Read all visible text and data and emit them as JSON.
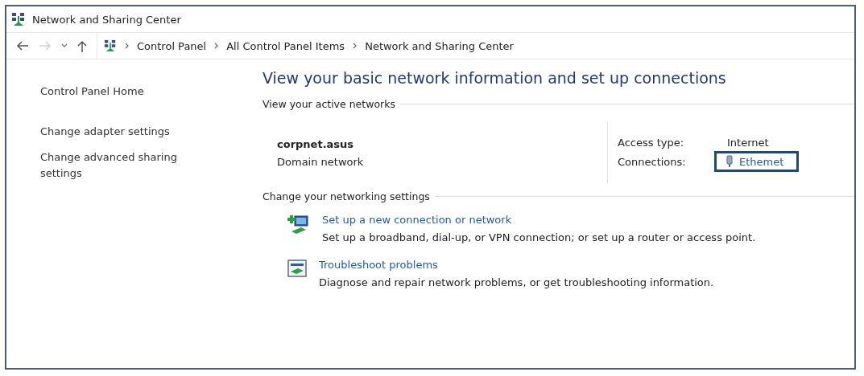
{
  "window": {
    "title": "Network and Sharing Center"
  },
  "nav": {
    "back": {
      "disabled": false
    },
    "forward": {
      "disabled": true
    }
  },
  "breadcrumb": [
    "Control Panel",
    "All Control Panel Items",
    "Network and Sharing Center"
  ],
  "sidebar": {
    "items": [
      {
        "label": "Control Panel Home"
      },
      {
        "label": "Change adapter settings"
      },
      {
        "label": "Change advanced sharing settings"
      }
    ]
  },
  "heading": "View your basic network information and set up connections",
  "active_networks": {
    "section": "View your active networks",
    "name": "corpnet.asus",
    "category": "Domain network",
    "access_label": "Access type:",
    "access_value": "Internet",
    "connections_label": "Connections:",
    "connection": {
      "label": "Ethemet",
      "focused": true
    }
  },
  "settings": {
    "section": "Change your networking settings",
    "tasks": [
      {
        "kind": "new-connection",
        "title": "Set up a new connection or network",
        "description": "Set up a broadband, dial-up, or VPN connection; or set up a router or access point."
      },
      {
        "kind": "troubleshoot",
        "title": "Troubleshoot problems",
        "description": "Diagnose and repair network problems, or get troubleshooting information."
      }
    ]
  }
}
